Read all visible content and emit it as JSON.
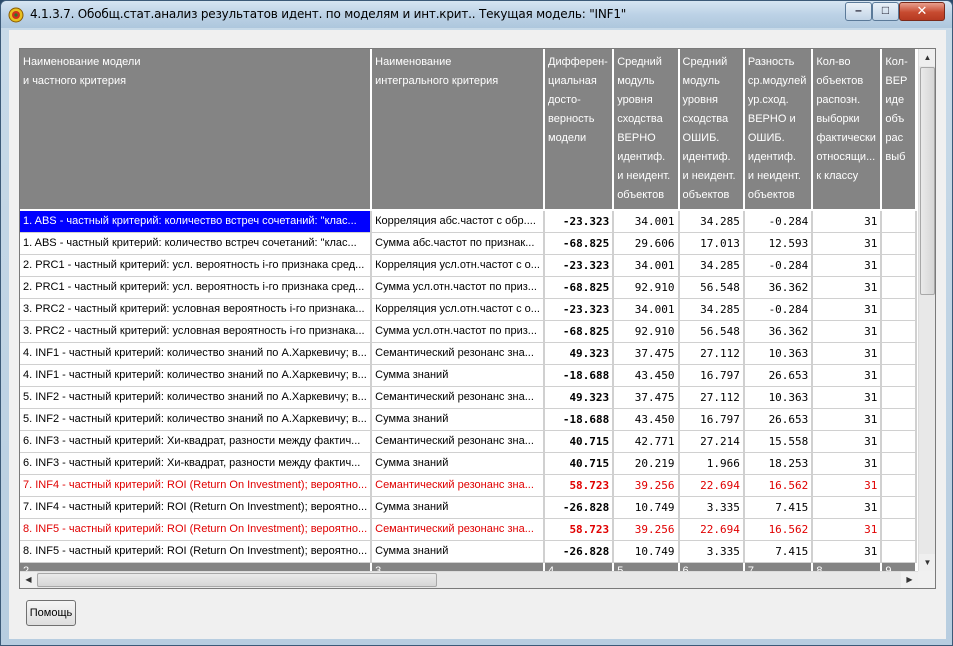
{
  "window": {
    "title": "4.1.3.7. Обобщ.стат.анализ результатов идент. по моделям и инт.крит.. Текущая модель: \"INF1\"",
    "minimize_glyph": "–",
    "maximize_glyph": "□",
    "close_glyph": "✕"
  },
  "grid": {
    "columns": [
      [
        "Наименование модели",
        "и частного критерия"
      ],
      [
        "Наименование",
        "интегрального критерия"
      ],
      [
        "Дифферен-",
        "циальная",
        "досто-",
        "верность",
        "модели"
      ],
      [
        "Средний",
        "модуль",
        "уровня",
        "сходства",
        "ВЕРНО",
        "идентиф.",
        "и неидент.",
        "объектов"
      ],
      [
        "Средний",
        "модуль",
        "уровня",
        "сходства",
        "ОШИБ.",
        "идентиф.",
        "и неидент.",
        "объектов"
      ],
      [
        "Разность",
        "ср.модулей",
        "ур.сход.",
        "ВЕРНО и",
        "ОШИБ.",
        "идентиф.",
        "и неидент.",
        "объектов"
      ],
      [
        "Кол-во",
        "объектов",
        "распозн.",
        "выборки",
        "фактически",
        "относящи...",
        "к классу"
      ],
      [
        "Кол-",
        "ВЕР",
        "иде",
        "объ",
        "рас",
        "выб"
      ]
    ],
    "rows": [
      {
        "model": "1. ABS  - частный критерий: количество встреч сочетаний: \"клас...",
        "integral": "Корреляция абс.частот с обр....",
        "diff": "-23.323",
        "avg_correct": "34.001",
        "avg_error": "34.285",
        "delta": "-0.284",
        "count": "31",
        "red": false,
        "selected": true
      },
      {
        "model": "1. ABS  - частный критерий: количество встреч сочетаний: \"клас...",
        "integral": "Сумма абс.частот по признак...",
        "diff": "-68.825",
        "avg_correct": "29.606",
        "avg_error": "17.013",
        "delta": "12.593",
        "count": "31",
        "red": false,
        "selected": false
      },
      {
        "model": "2. PRC1 - частный критерий: усл. вероятность i-го признака сред...",
        "integral": "Корреляция усл.отн.частот с о...",
        "diff": "-23.323",
        "avg_correct": "34.001",
        "avg_error": "34.285",
        "delta": "-0.284",
        "count": "31",
        "red": false,
        "selected": false
      },
      {
        "model": "2. PRC1 - частный критерий: усл. вероятность i-го признака сред...",
        "integral": "Сумма усл.отн.частот по приз...",
        "diff": "-68.825",
        "avg_correct": "92.910",
        "avg_error": "56.548",
        "delta": "36.362",
        "count": "31",
        "red": false,
        "selected": false
      },
      {
        "model": "3. PRC2 - частный критерий: условная вероятность i-го признака...",
        "integral": "Корреляция усл.отн.частот с о...",
        "diff": "-23.323",
        "avg_correct": "34.001",
        "avg_error": "34.285",
        "delta": "-0.284",
        "count": "31",
        "red": false,
        "selected": false
      },
      {
        "model": "3. PRC2 - частный критерий: условная вероятность i-го признака...",
        "integral": "Сумма усл.отн.частот по приз...",
        "diff": "-68.825",
        "avg_correct": "92.910",
        "avg_error": "56.548",
        "delta": "36.362",
        "count": "31",
        "red": false,
        "selected": false
      },
      {
        "model": "4. INF1 - частный критерий: количество знаний по А.Харкевичу; в...",
        "integral": "Семантический резонанс зна...",
        "diff": "49.323",
        "avg_correct": "37.475",
        "avg_error": "27.112",
        "delta": "10.363",
        "count": "31",
        "red": false,
        "selected": false
      },
      {
        "model": "4. INF1 - частный критерий: количество знаний по А.Харкевичу; в...",
        "integral": "Сумма знаний",
        "diff": "-18.688",
        "avg_correct": "43.450",
        "avg_error": "16.797",
        "delta": "26.653",
        "count": "31",
        "red": false,
        "selected": false
      },
      {
        "model": "5. INF2 - частный критерий: количество знаний по А.Харкевичу; в...",
        "integral": "Семантический резонанс зна...",
        "diff": "49.323",
        "avg_correct": "37.475",
        "avg_error": "27.112",
        "delta": "10.363",
        "count": "31",
        "red": false,
        "selected": false
      },
      {
        "model": "5. INF2 - частный критерий: количество знаний по А.Харкевичу; в...",
        "integral": "Сумма знаний",
        "diff": "-18.688",
        "avg_correct": "43.450",
        "avg_error": "16.797",
        "delta": "26.653",
        "count": "31",
        "red": false,
        "selected": false
      },
      {
        "model": "6. INF3 - частный критерий: Хи-квадрат, разности между фактич...",
        "integral": "Семантический резонанс зна...",
        "diff": "40.715",
        "avg_correct": "42.771",
        "avg_error": "27.214",
        "delta": "15.558",
        "count": "31",
        "red": false,
        "selected": false
      },
      {
        "model": "6. INF3 - частный критерий: Хи-квадрат, разности между фактич...",
        "integral": "Сумма знаний",
        "diff": "40.715",
        "avg_correct": "20.219",
        "avg_error": "1.966",
        "delta": "18.253",
        "count": "31",
        "red": false,
        "selected": false
      },
      {
        "model": "7. INF4 - частный критерий: ROI (Return On Investment); вероятно...",
        "integral": "Семантический резонанс зна...",
        "diff": "58.723",
        "avg_correct": "39.256",
        "avg_error": "22.694",
        "delta": "16.562",
        "count": "31",
        "red": true,
        "selected": false
      },
      {
        "model": "7. INF4 - частный критерий: ROI (Return On Investment); вероятно...",
        "integral": "Сумма знаний",
        "diff": "-26.828",
        "avg_correct": "10.749",
        "avg_error": "3.335",
        "delta": "7.415",
        "count": "31",
        "red": false,
        "selected": false
      },
      {
        "model": "8. INF5 - частный критерий: ROI (Return On Investment); вероятно...",
        "integral": "Семантический резонанс зна...",
        "diff": "58.723",
        "avg_correct": "39.256",
        "avg_error": "22.694",
        "delta": "16.562",
        "count": "31",
        "red": true,
        "selected": false
      },
      {
        "model": "8. INF5 - частный критерий: ROI (Return On Investment); вероятно...",
        "integral": "Сумма знаний",
        "diff": "-26.828",
        "avg_correct": "10.749",
        "avg_error": "3.335",
        "delta": "7.415",
        "count": "31",
        "red": false,
        "selected": false
      }
    ],
    "footer": [
      "2",
      "3",
      "4",
      "5",
      "6",
      "7",
      "8",
      "9"
    ]
  },
  "help_button": {
    "label": "Помощь"
  },
  "colors": {
    "header_bg": "#848484",
    "selection": "#0000ff",
    "highlight_text": "#e00000"
  }
}
